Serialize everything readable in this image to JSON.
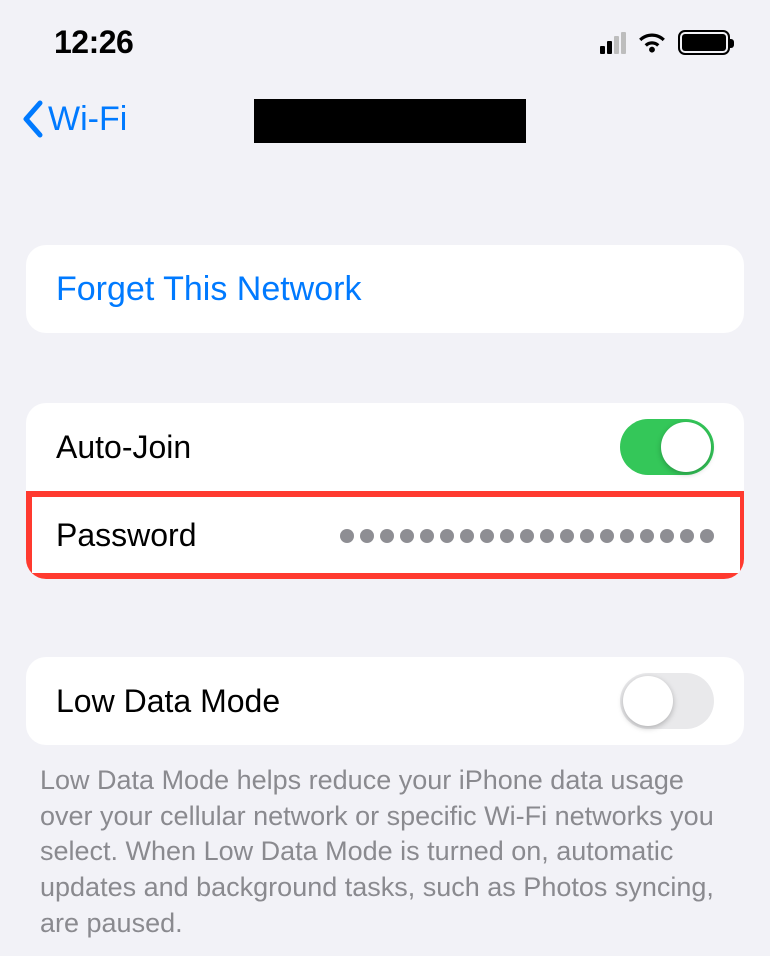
{
  "statusBar": {
    "time": "12:26"
  },
  "nav": {
    "backLabel": "Wi-Fi"
  },
  "forget": {
    "label": "Forget This Network"
  },
  "autoJoin": {
    "label": "Auto-Join",
    "on": true
  },
  "password": {
    "label": "Password",
    "maskedLength": 19
  },
  "lowData": {
    "label": "Low Data Mode",
    "on": false,
    "description": "Low Data Mode helps reduce your iPhone data usage over your cellular network or specific Wi-Fi networks you select. When Low Data Mode is turned on, automatic updates and background tasks, such as Photos syncing, are paused."
  }
}
